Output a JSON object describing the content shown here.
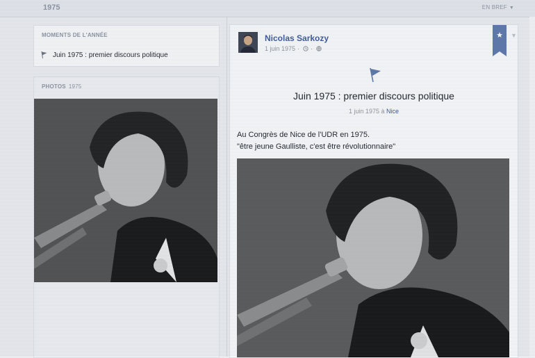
{
  "header": {
    "year": "1975",
    "filter_label": "EN BREF"
  },
  "sidebar": {
    "moments": {
      "title": "MOMENTS DE L'ANNÉE",
      "items": [
        {
          "label": "Juin 1975 : premier discours politique"
        }
      ]
    },
    "photos": {
      "title": "PHOTOS",
      "year": "1975"
    }
  },
  "post": {
    "author": "Nicolas Sarkozy",
    "date": "1 juin 1975",
    "event_title": "Juin 1975 : premier discours politique",
    "event_date": "1 juin 1975",
    "event_at": "à",
    "event_place": "Nice",
    "text_line_1": "Au Congrès de Nice de l'UDR en 1975.",
    "text_line_2": "\"être jeune Gaulliste, c'est être révolutionnaire\""
  },
  "colors": {
    "link": "#3b5998",
    "ribbon": "#5b76a8",
    "background": "#e9ebee"
  },
  "icons": [
    "flag-icon",
    "clock-icon",
    "globe-icon",
    "star-icon",
    "chevron-down-icon"
  ]
}
